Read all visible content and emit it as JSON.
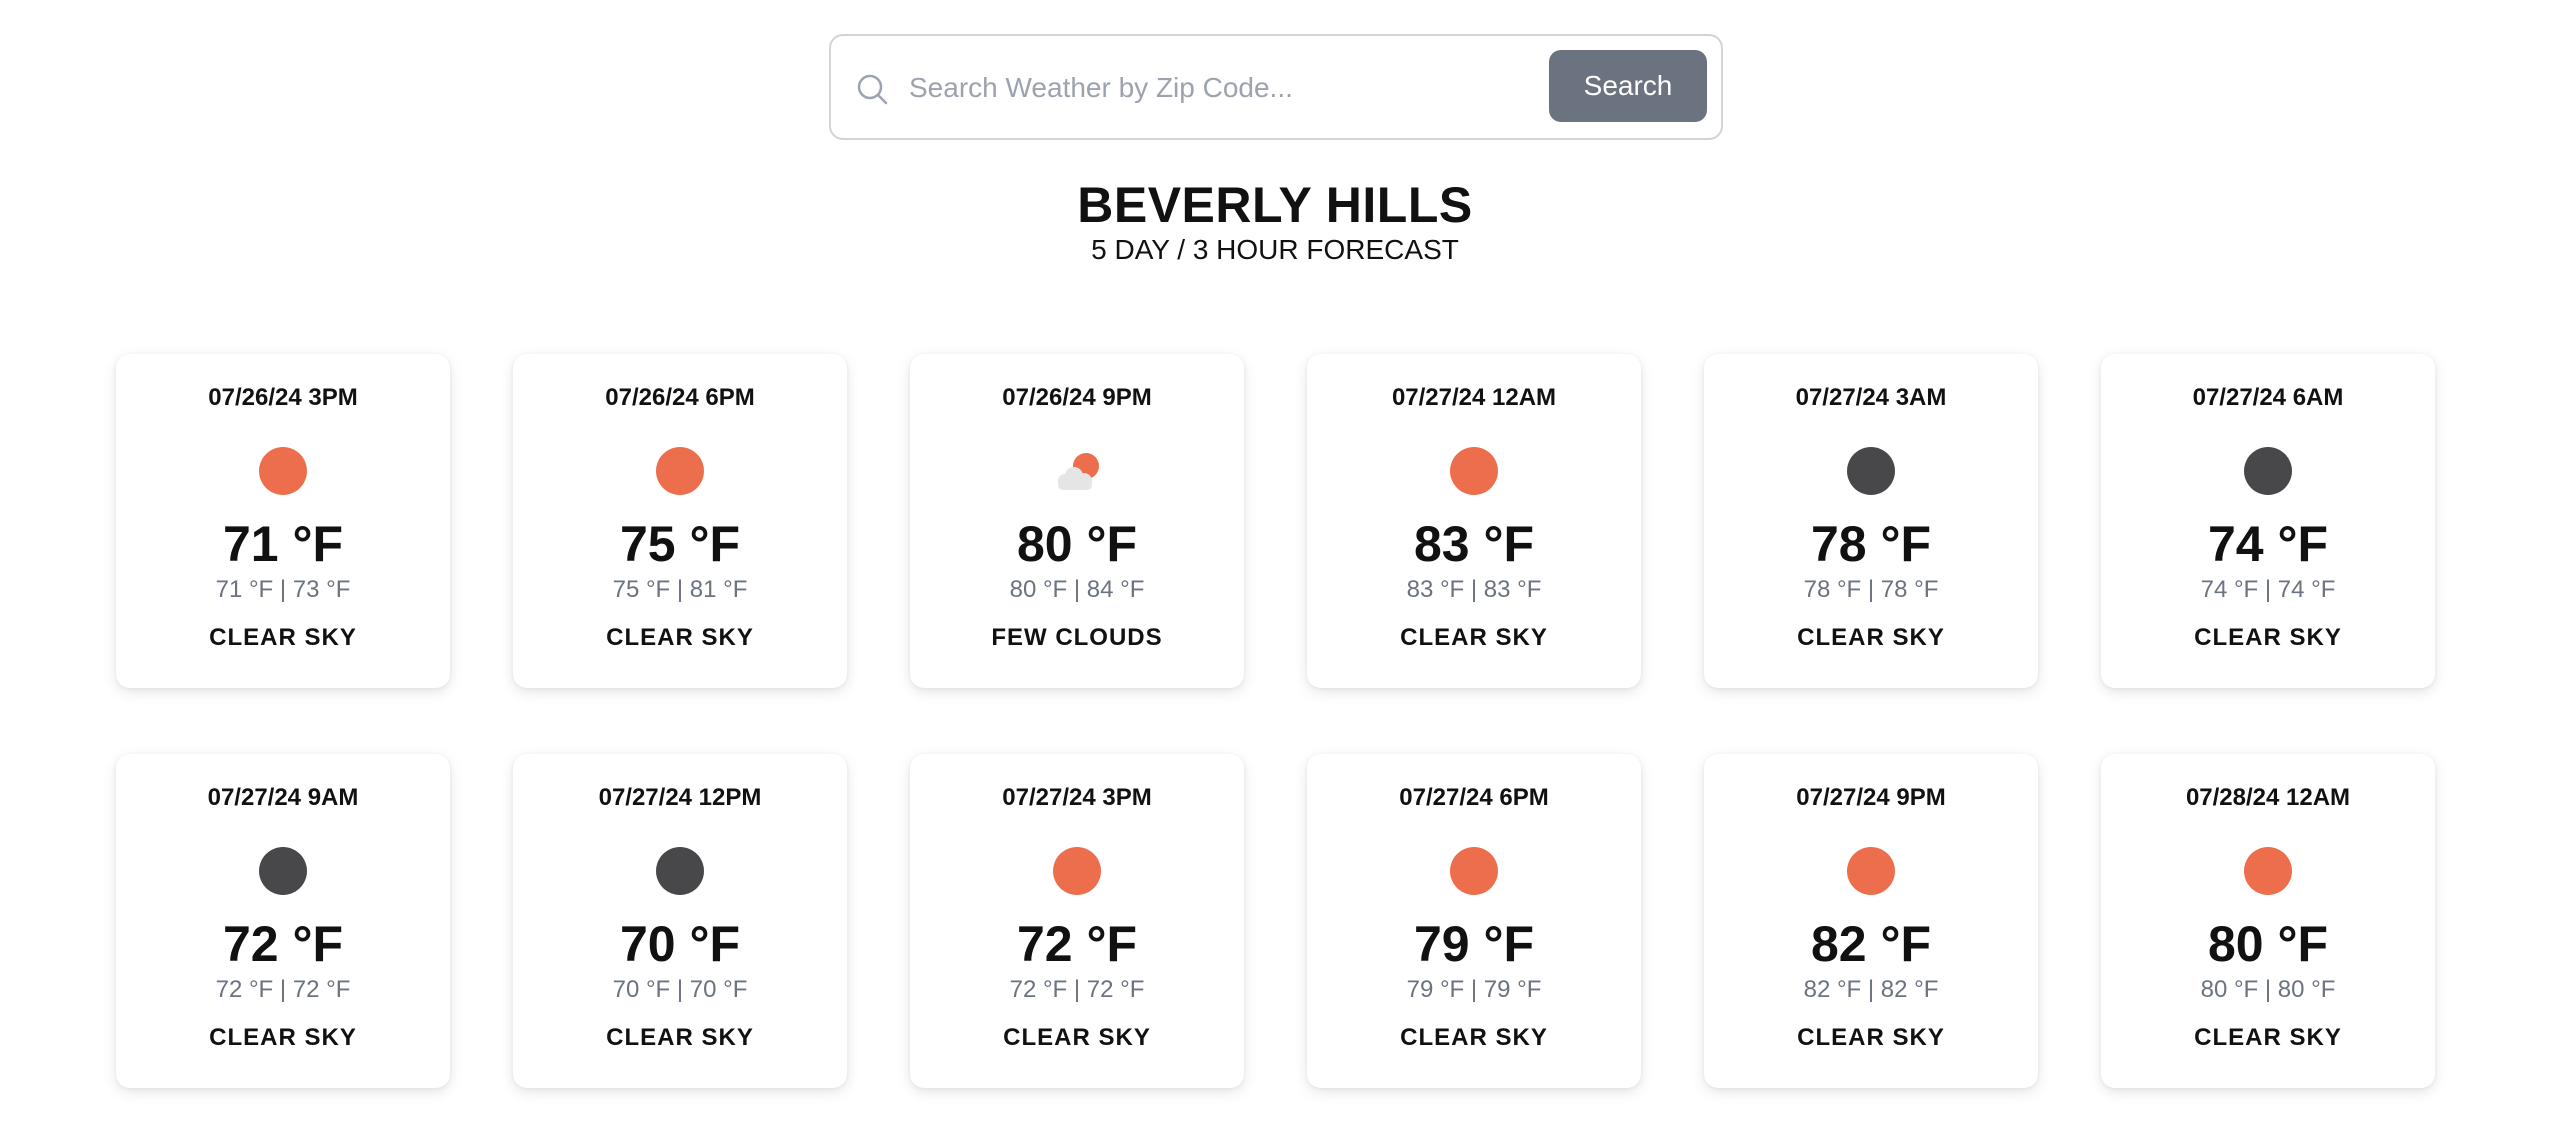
{
  "search": {
    "placeholder": "Search Weather by Zip Code...",
    "value": "",
    "button_label": "Search"
  },
  "location": {
    "city": "BEVERLY HILLS",
    "subtitle": "5 DAY / 3 HOUR FORECAST"
  },
  "icon_colors": {
    "clear-sky-day": "#ec6e4c",
    "clear-sky-night": "#48484a",
    "cloud": "#e5e5e5"
  },
  "forecast": [
    {
      "time": "07/26/24 3PM",
      "icon": "clear-sky-day",
      "temp": "71 °F",
      "range": "71 °F | 73 °F",
      "description": "CLEAR SKY"
    },
    {
      "time": "07/26/24 6PM",
      "icon": "clear-sky-day",
      "temp": "75 °F",
      "range": "75 °F | 81 °F",
      "description": "CLEAR SKY"
    },
    {
      "time": "07/26/24 9PM",
      "icon": "few-clouds",
      "temp": "80 °F",
      "range": "80 °F | 84 °F",
      "description": "FEW CLOUDS"
    },
    {
      "time": "07/27/24 12AM",
      "icon": "clear-sky-day",
      "temp": "83 °F",
      "range": "83 °F | 83 °F",
      "description": "CLEAR SKY"
    },
    {
      "time": "07/27/24 3AM",
      "icon": "clear-sky-night",
      "temp": "78 °F",
      "range": "78 °F | 78 °F",
      "description": "CLEAR SKY"
    },
    {
      "time": "07/27/24 6AM",
      "icon": "clear-sky-night",
      "temp": "74 °F",
      "range": "74 °F | 74 °F",
      "description": "CLEAR SKY"
    },
    {
      "time": "07/27/24 9AM",
      "icon": "clear-sky-night",
      "temp": "72 °F",
      "range": "72 °F | 72 °F",
      "description": "CLEAR SKY"
    },
    {
      "time": "07/27/24 12PM",
      "icon": "clear-sky-night",
      "temp": "70 °F",
      "range": "70 °F | 70 °F",
      "description": "CLEAR SKY"
    },
    {
      "time": "07/27/24 3PM",
      "icon": "clear-sky-day",
      "temp": "72 °F",
      "range": "72 °F | 72 °F",
      "description": "CLEAR SKY"
    },
    {
      "time": "07/27/24 6PM",
      "icon": "clear-sky-day",
      "temp": "79 °F",
      "range": "79 °F | 79 °F",
      "description": "CLEAR SKY"
    },
    {
      "time": "07/27/24 9PM",
      "icon": "clear-sky-day",
      "temp": "82 °F",
      "range": "82 °F | 82 °F",
      "description": "CLEAR SKY"
    },
    {
      "time": "07/28/24 12AM",
      "icon": "clear-sky-day",
      "temp": "80 °F",
      "range": "80 °F | 80 °F",
      "description": "CLEAR SKY"
    }
  ]
}
